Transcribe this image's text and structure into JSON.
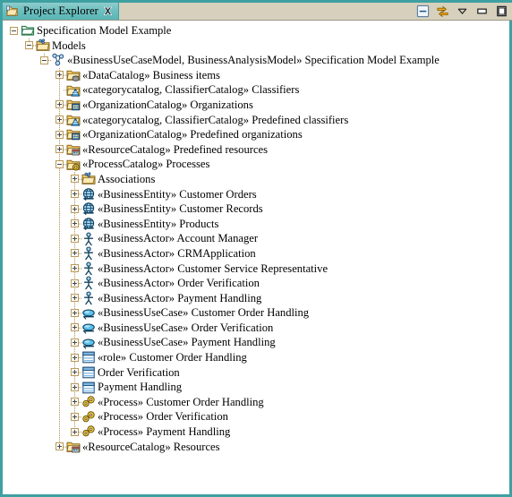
{
  "view": {
    "tab_title": "Project Explorer",
    "tab_icon": "project-explorer-icon",
    "close_icon": "close-icon",
    "accent_color": "#3fa0a2",
    "titlebar_color": "#d6d0bc",
    "toolbar": [
      {
        "name": "collapse-all-button",
        "icon": "collapse-all-icon"
      },
      {
        "name": "link-with-editor-button",
        "icon": "link-editor-icon"
      },
      {
        "name": "view-menu-button",
        "icon": "chevron-down-icon"
      },
      {
        "name": "minimize-button",
        "icon": "minimize-icon"
      },
      {
        "name": "maximize-button",
        "icon": "maximize-icon"
      }
    ]
  },
  "tree": {
    "rows": [
      {
        "depth": 0,
        "state": "expanded",
        "icon": "project-folder-icon",
        "label": "Specification Model Example"
      },
      {
        "depth": 1,
        "state": "expanded",
        "icon": "models-folder-icon",
        "label": "Models"
      },
      {
        "depth": 2,
        "state": "expanded",
        "icon": "business-model-icon",
        "label": "«BusinessUseCaseModel, BusinessAnalysisModel» Specification Model Example"
      },
      {
        "depth": 3,
        "state": "collapsed",
        "icon": "data-catalog-icon",
        "label": "«DataCatalog» Business items"
      },
      {
        "depth": 3,
        "state": "leaf",
        "icon": "classifier-catalog-icon",
        "label": "«categorycatalog, ClassifierCatalog» Classifiers"
      },
      {
        "depth": 3,
        "state": "collapsed",
        "icon": "organization-catalog-icon",
        "label": "«OrganizationCatalog» Organizations"
      },
      {
        "depth": 3,
        "state": "collapsed",
        "icon": "classifier-catalog-icon",
        "label": "«categorycatalog, ClassifierCatalog» Predefined classifiers"
      },
      {
        "depth": 3,
        "state": "collapsed",
        "icon": "organization-catalog-icon",
        "label": "«OrganizationCatalog» Predefined organizations"
      },
      {
        "depth": 3,
        "state": "collapsed",
        "icon": "resource-catalog-icon",
        "label": "«ResourceCatalog» Predefined resources"
      },
      {
        "depth": 3,
        "state": "expanded",
        "icon": "process-catalog-icon",
        "label": "«ProcessCatalog» Processes"
      },
      {
        "depth": 4,
        "state": "collapsed",
        "icon": "associations-folder-icon",
        "label": "Associations"
      },
      {
        "depth": 4,
        "state": "collapsed",
        "icon": "business-entity-icon",
        "label": "«BusinessEntity» Customer Orders"
      },
      {
        "depth": 4,
        "state": "collapsed",
        "icon": "business-entity-icon",
        "label": "«BusinessEntity» Customer Records"
      },
      {
        "depth": 4,
        "state": "collapsed",
        "icon": "business-entity-icon",
        "label": "«BusinessEntity» Products"
      },
      {
        "depth": 4,
        "state": "collapsed",
        "icon": "business-actor-icon",
        "label": "«BusinessActor» Account Manager"
      },
      {
        "depth": 4,
        "state": "collapsed",
        "icon": "business-actor-icon",
        "label": "«BusinessActor» CRMApplication"
      },
      {
        "depth": 4,
        "state": "collapsed",
        "icon": "business-actor-icon",
        "label": "«BusinessActor» Customer Service Representative"
      },
      {
        "depth": 4,
        "state": "collapsed",
        "icon": "business-actor-icon",
        "label": "«BusinessActor» Order Verification"
      },
      {
        "depth": 4,
        "state": "collapsed",
        "icon": "business-actor-icon",
        "label": "«BusinessActor» Payment Handling"
      },
      {
        "depth": 4,
        "state": "collapsed",
        "icon": "business-usecase-icon",
        "label": "«BusinessUseCase» Customer Order Handling"
      },
      {
        "depth": 4,
        "state": "collapsed",
        "icon": "business-usecase-icon",
        "label": "«BusinessUseCase» Order Verification"
      },
      {
        "depth": 4,
        "state": "collapsed",
        "icon": "business-usecase-icon",
        "label": "«BusinessUseCase» Payment Handling"
      },
      {
        "depth": 4,
        "state": "collapsed",
        "icon": "role-class-icon",
        "label": "«role» Customer Order Handling"
      },
      {
        "depth": 4,
        "state": "collapsed",
        "icon": "role-class-icon",
        "label": "Order Verification"
      },
      {
        "depth": 4,
        "state": "collapsed",
        "icon": "role-class-icon",
        "label": "Payment Handling"
      },
      {
        "depth": 4,
        "state": "collapsed",
        "icon": "process-icon",
        "label": "«Process» Customer Order Handling"
      },
      {
        "depth": 4,
        "state": "collapsed",
        "icon": "process-icon",
        "label": "«Process» Order Verification"
      },
      {
        "depth": 4,
        "state": "collapsed",
        "icon": "process-icon",
        "label": "«Process» Payment Handling"
      },
      {
        "depth": 3,
        "state": "collapsed",
        "icon": "resource-catalog-icon",
        "label": "«ResourceCatalog» Resources"
      }
    ]
  }
}
